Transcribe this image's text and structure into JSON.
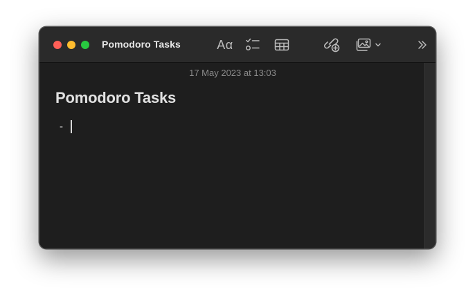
{
  "window": {
    "title": "Pomodoro Tasks"
  },
  "toolbar": {
    "format_label": "Aα"
  },
  "note": {
    "date": "17 May 2023 at 13:03",
    "title": "Pomodoro Tasks",
    "lines": [
      {
        "bullet": "-",
        "text": ""
      }
    ]
  },
  "icons": {
    "format": "text-format-icon",
    "checklist": "checklist-icon",
    "table": "table-icon",
    "collaborate": "collaborate-link-icon",
    "media": "photo-media-icon",
    "more": "double-chevron-right-icon"
  },
  "colors": {
    "close": "#fe5f57",
    "minimize": "#febc2e",
    "zoom": "#28c840",
    "background": "#1e1e1e",
    "titlebar": "#2a2a2a"
  }
}
